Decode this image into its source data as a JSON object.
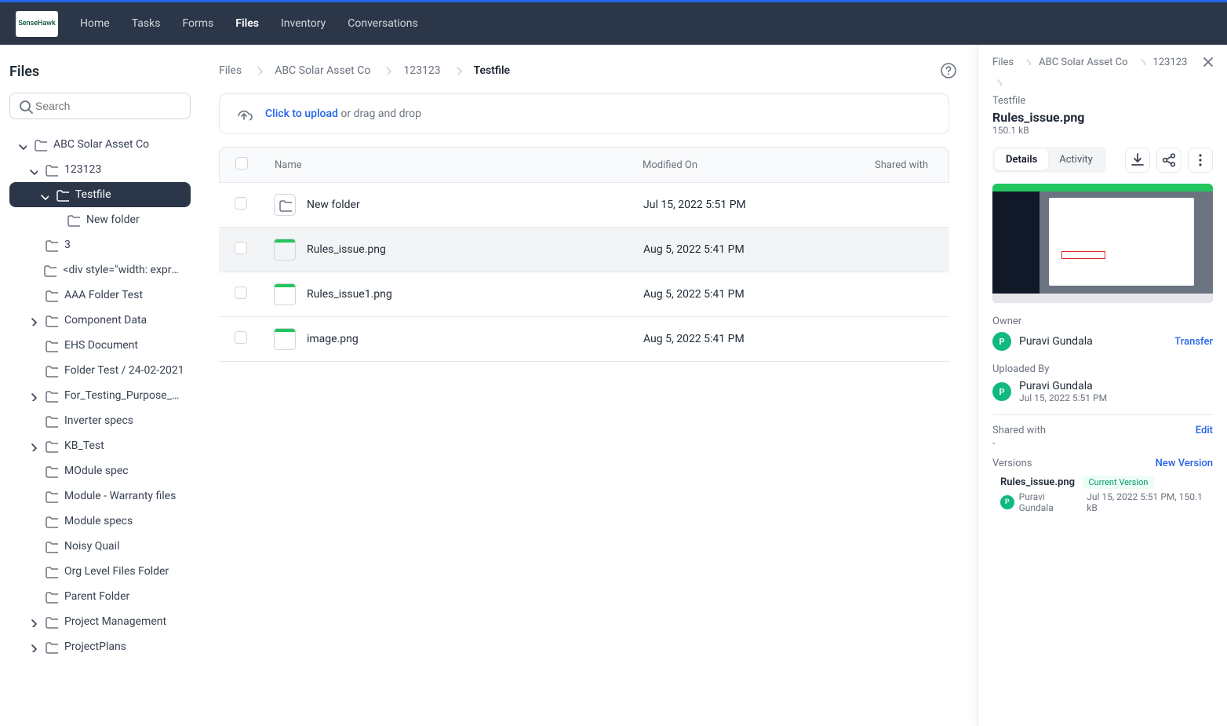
{
  "nav": {
    "logo": "SenseHawk",
    "links": [
      "Home",
      "Tasks",
      "Forms",
      "Files",
      "Inventory",
      "Conversations"
    ],
    "active": "Files"
  },
  "sidebar": {
    "title": "Files",
    "search_placeholder": "Search",
    "tree": [
      {
        "label": "ABC Solar Asset Co",
        "depth": 0,
        "chev": "down",
        "icon": "folder"
      },
      {
        "label": "123123",
        "depth": 1,
        "chev": "down",
        "icon": "folder"
      },
      {
        "label": "Testfile",
        "depth": 2,
        "chev": "down",
        "icon": "folder",
        "active": true
      },
      {
        "label": "New folder",
        "depth": 3,
        "chev": "",
        "icon": "folder"
      },
      {
        "label": "3",
        "depth": 1,
        "chev": "",
        "icon": "folder"
      },
      {
        "label": "<div style=\"width: expressi...",
        "depth": 1,
        "chev": "",
        "icon": "folder"
      },
      {
        "label": "AAA Folder Test",
        "depth": 1,
        "chev": "",
        "icon": "folder"
      },
      {
        "label": "Component Data",
        "depth": 1,
        "chev": "right",
        "icon": "folder"
      },
      {
        "label": "EHS Document",
        "depth": 1,
        "chev": "",
        "icon": "folder"
      },
      {
        "label": "Folder Test / 24-02-2021",
        "depth": 1,
        "chev": "",
        "icon": "folder"
      },
      {
        "label": "For_Testing_Purpose_Only",
        "depth": 1,
        "chev": "right",
        "icon": "folder"
      },
      {
        "label": "Inverter specs",
        "depth": 1,
        "chev": "",
        "icon": "folder"
      },
      {
        "label": "KB_Test",
        "depth": 1,
        "chev": "right",
        "icon": "folder"
      },
      {
        "label": "MOdule spec",
        "depth": 1,
        "chev": "",
        "icon": "folder"
      },
      {
        "label": "Module - Warranty files",
        "depth": 1,
        "chev": "",
        "icon": "folder"
      },
      {
        "label": "Module specs",
        "depth": 1,
        "chev": "",
        "icon": "folder"
      },
      {
        "label": "Noisy Quail",
        "depth": 1,
        "chev": "",
        "icon": "folder"
      },
      {
        "label": "Org Level Files Folder",
        "depth": 1,
        "chev": "",
        "icon": "folder"
      },
      {
        "label": "Parent Folder",
        "depth": 1,
        "chev": "",
        "icon": "folder"
      },
      {
        "label": "Project Management",
        "depth": 1,
        "chev": "right",
        "icon": "folder"
      },
      {
        "label": "ProjectPlans",
        "depth": 1,
        "chev": "right",
        "icon": "folder"
      }
    ]
  },
  "breadcrumb": [
    "Files",
    "ABC Solar Asset Co",
    "123123",
    "Testfile"
  ],
  "upload": {
    "link_text": "Click to upload",
    "rest": " or drag and drop"
  },
  "table": {
    "headers": {
      "name": "Name",
      "modified": "Modified On",
      "shared": "Shared with"
    },
    "rows": [
      {
        "type": "folder",
        "name": "New folder",
        "modified": "Jul 15, 2022 5:51 PM",
        "selected": false
      },
      {
        "type": "file",
        "name": "Rules_issue.png",
        "modified": "Aug 5, 2022 5:41 PM",
        "selected": true
      },
      {
        "type": "file",
        "name": "Rules_issue1.png",
        "modified": "Aug 5, 2022 5:41 PM",
        "selected": false
      },
      {
        "type": "file",
        "name": "image.png",
        "modified": "Aug 5, 2022 5:41 PM",
        "selected": false
      }
    ]
  },
  "panel": {
    "crumbs": [
      "Files",
      "ABC Solar Asset Co",
      "123123"
    ],
    "subfolder": "Testfile",
    "filename": "Rules_issue.png",
    "size": "150.1 kB",
    "tabs": {
      "details": "Details",
      "activity": "Activity"
    },
    "owner_label": "Owner",
    "owner_name": "Puravi Gundala",
    "owner_initial": "P",
    "transfer": "Transfer",
    "uploaded_by_label": "Uploaded By",
    "uploaded_by_name": "Puravi Gundala",
    "uploaded_by_date": "Jul 15, 2022 5:51 PM",
    "shared_label": "Shared with",
    "shared_value": "-",
    "edit": "Edit",
    "versions_label": "Versions",
    "new_version": "New Version",
    "version_file": "Rules_issue.png",
    "version_badge": "Current Version",
    "version_user": "Puravi Gundala",
    "version_meta": "Jul 15, 2022 5:51 PM, 150.1 kB"
  }
}
